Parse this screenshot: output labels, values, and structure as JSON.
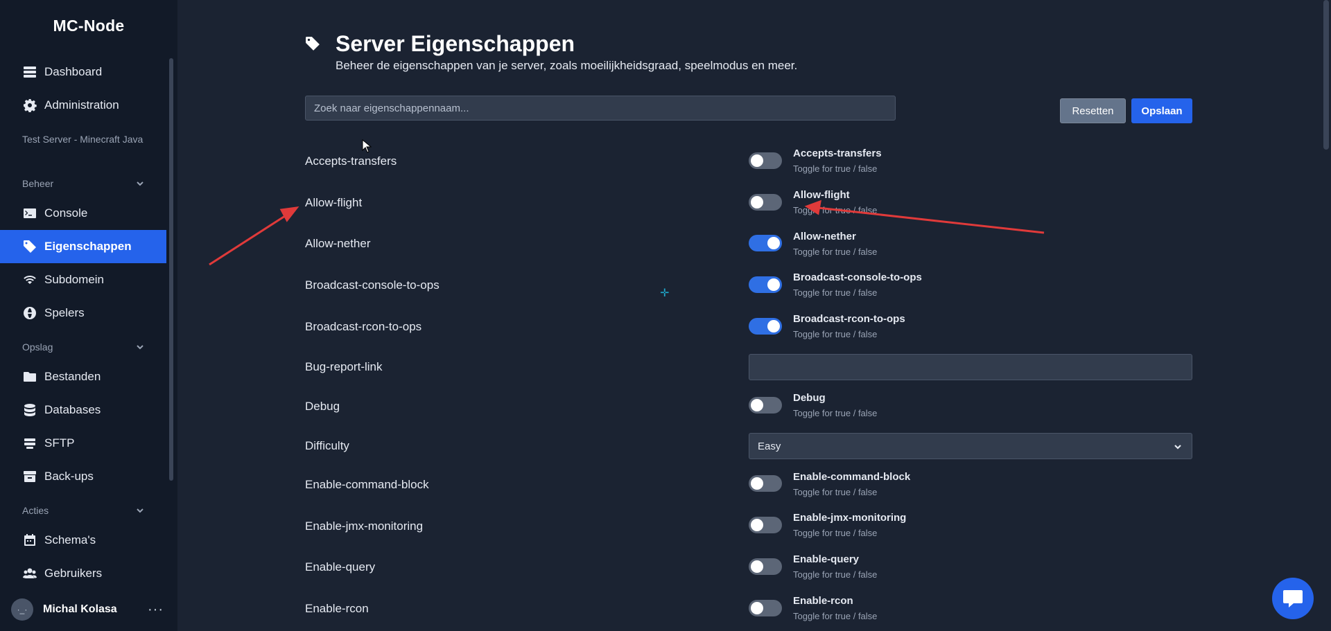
{
  "sidebar": {
    "brand": "MC-Node",
    "top_items": [
      {
        "label": "Dashboard",
        "icon": "server-stack-icon"
      },
      {
        "label": "Administration",
        "icon": "gear-icon"
      }
    ],
    "server_name": "Test Server - Minecraft Java",
    "sections": [
      {
        "label": "Beheer",
        "items": [
          {
            "label": "Console",
            "icon": "terminal-icon"
          },
          {
            "label": "Eigenschappen",
            "icon": "tag-icon",
            "active": true
          },
          {
            "label": "Subdomein",
            "icon": "wifi-icon"
          },
          {
            "label": "Spelers",
            "icon": "globe-icon"
          }
        ]
      },
      {
        "label": "Opslag",
        "items": [
          {
            "label": "Bestanden",
            "icon": "folder-icon"
          },
          {
            "label": "Databases",
            "icon": "database-icon"
          },
          {
            "label": "SFTP",
            "icon": "sftp-icon"
          },
          {
            "label": "Back-ups",
            "icon": "archive-icon"
          }
        ]
      },
      {
        "label": "Acties",
        "items": [
          {
            "label": "Schema's",
            "icon": "calendar-icon"
          },
          {
            "label": "Gebruikers",
            "icon": "users-icon"
          }
        ]
      }
    ],
    "user": {
      "name": "Michal Kolasa",
      "avatar_text": "·_·",
      "more": "···"
    }
  },
  "header": {
    "icon": "tag-icon",
    "title": "Server Eigenschappen",
    "subtitle": "Beheer de eigenschappen van je server, zoals moeilijkheidsgraad, speelmodus en meer."
  },
  "search": {
    "placeholder": "Zoek naar eigenschappennaam...",
    "value": ""
  },
  "buttons": {
    "reset": "Resetten",
    "save": "Opslaan"
  },
  "toggle_hint": "Toggle for true / false",
  "properties": [
    {
      "label": "Accepts-transfers",
      "type": "toggle",
      "value": false
    },
    {
      "label": "Allow-flight",
      "type": "toggle",
      "value": false
    },
    {
      "label": "Allow-nether",
      "type": "toggle",
      "value": true
    },
    {
      "label": "Broadcast-console-to-ops",
      "type": "toggle",
      "value": true
    },
    {
      "label": "Broadcast-rcon-to-ops",
      "type": "toggle",
      "value": true
    },
    {
      "label": "Bug-report-link",
      "type": "text",
      "value": ""
    },
    {
      "label": "Debug",
      "type": "toggle",
      "value": false
    },
    {
      "label": "Difficulty",
      "type": "select",
      "value": "Easy"
    },
    {
      "label": "Enable-command-block",
      "type": "toggle",
      "value": false
    },
    {
      "label": "Enable-jmx-monitoring",
      "type": "toggle",
      "value": false
    },
    {
      "label": "Enable-query",
      "type": "toggle",
      "value": false
    },
    {
      "label": "Enable-rcon",
      "type": "toggle",
      "value": false
    }
  ],
  "colors": {
    "accent": "#2563eb",
    "annotation_arrow": "#e03a3a",
    "background": "#1b2332",
    "sidebar": "#121a28"
  }
}
